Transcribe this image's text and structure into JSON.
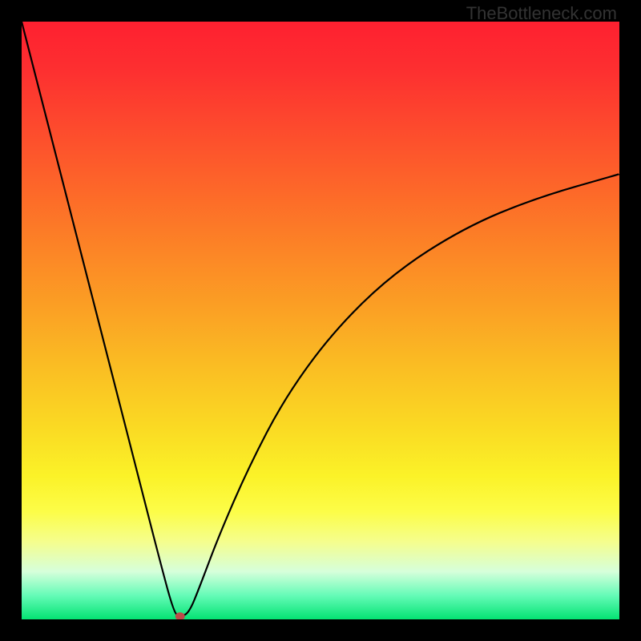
{
  "attribution": "TheBottleneck.com",
  "chart_data": {
    "type": "line",
    "title": "",
    "xlabel": "",
    "ylabel": "",
    "xlim": [
      0,
      1
    ],
    "ylim": [
      0,
      1
    ],
    "series": [
      {
        "name": "curve",
        "x": [
          0.0,
          0.05,
          0.1,
          0.15,
          0.2,
          0.23,
          0.255,
          0.265,
          0.28,
          0.3,
          0.33,
          0.38,
          0.44,
          0.52,
          0.62,
          0.74,
          0.86,
          1.0
        ],
        "y": [
          1.0,
          0.805,
          0.61,
          0.415,
          0.22,
          0.103,
          0.01,
          0.005,
          0.01,
          0.06,
          0.14,
          0.255,
          0.37,
          0.48,
          0.578,
          0.655,
          0.705,
          0.745
        ]
      }
    ],
    "marker": {
      "x": 0.265,
      "y": 0.005
    },
    "colors": {
      "gradient_top": "#fe2030",
      "gradient_bottom": "#04e373",
      "curve": "#000000",
      "marker": "#bd4b49"
    }
  }
}
